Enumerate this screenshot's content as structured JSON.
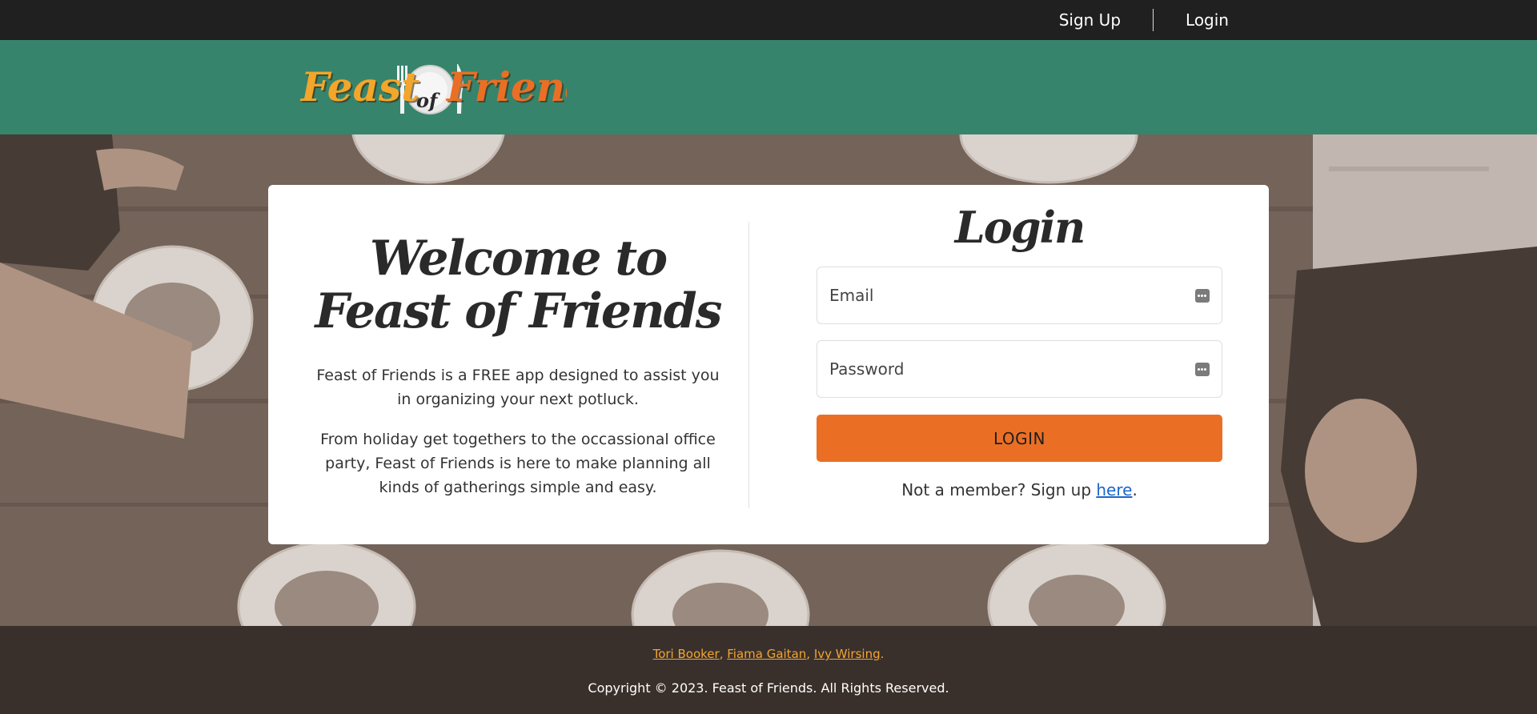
{
  "topnav": {
    "signup": "Sign Up",
    "login": "Login"
  },
  "logo": {
    "part1": "Feast",
    "part2": "of",
    "part3": "Friends"
  },
  "welcome": {
    "line1": "Welcome to",
    "line2": "Feast of Friends"
  },
  "description": {
    "p1": "Feast of Friends is a FREE app designed to assist you in organizing your next potluck.",
    "p2": "From holiday get togethers to the occassional office party, Feast of Friends is here to make planning all kinds of gatherings simple and easy."
  },
  "login_form": {
    "title": "Login",
    "email_placeholder": "Email",
    "password_placeholder": "Password",
    "button": "LOGIN",
    "member_text": "Not a member? Sign up ",
    "member_link": "here",
    "member_end": "."
  },
  "footer": {
    "authors": [
      "Tori Booker",
      "Fiama Gaitan",
      "Ivy Wirsing"
    ],
    "copyright": "Copyright © 2023. Feast of Friends. All Rights Reserved."
  },
  "colors": {
    "topbar": "#202020",
    "header": "#37846d",
    "accent": "#ea6f24",
    "footer": "#3a302b",
    "link": "#1a66cc",
    "author_link": "#f2a531"
  },
  "icons": {
    "field_icon": "password-manager-key-icon"
  }
}
